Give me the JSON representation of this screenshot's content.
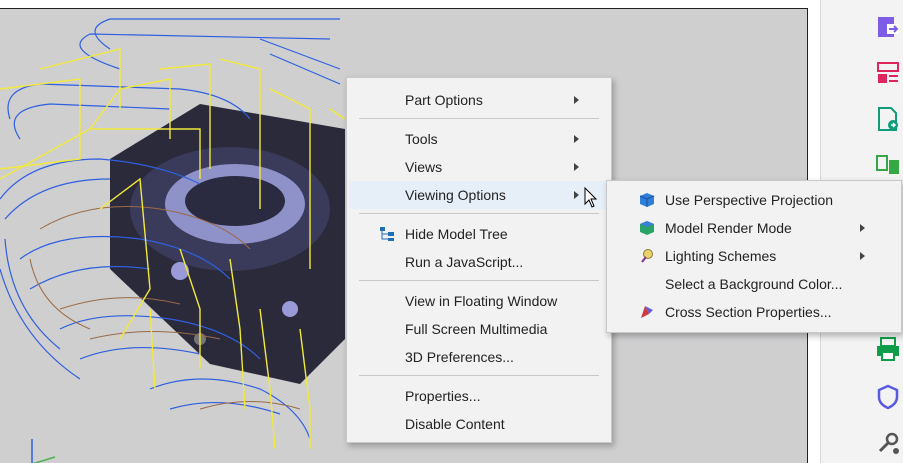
{
  "context_menu": {
    "items": [
      {
        "label": "Part Options",
        "has_submenu": true
      },
      {
        "label": "Tools",
        "has_submenu": true
      },
      {
        "label": "Views",
        "has_submenu": true
      },
      {
        "label": "Viewing Options",
        "has_submenu": true,
        "highlighted": true
      },
      {
        "label": "Hide Model Tree",
        "icon": "model-tree-icon"
      },
      {
        "label": "Run a JavaScript..."
      },
      {
        "label": "View in Floating Window"
      },
      {
        "label": "Full Screen Multimedia"
      },
      {
        "label": "3D Preferences..."
      },
      {
        "label": "Properties..."
      },
      {
        "label": "Disable Content"
      }
    ]
  },
  "viewing_options_submenu": {
    "items": [
      {
        "label": "Use Perspective Projection",
        "icon": "perspective-cube-icon"
      },
      {
        "label": "Model Render Mode",
        "icon": "render-mode-icon",
        "has_submenu": true
      },
      {
        "label": "Lighting Schemes",
        "icon": "lighting-icon",
        "has_submenu": true
      },
      {
        "label": "Select a Background Color..."
      },
      {
        "label": "Cross Section Properties...",
        "icon": "cross-section-icon"
      }
    ]
  },
  "colors": {
    "accent": "#4a63e0",
    "menu_highlight": "#e6eef8",
    "toolpath_yellow": "#f2e93a",
    "toolpath_blue": "#2f5fe0",
    "toolpath_brown": "#9a6a45"
  },
  "toolbar_icons": [
    "export-pdf-icon",
    "organize-pages-icon",
    "create-pdf-icon",
    "compare-icon",
    "print-production-icon",
    "protect-icon",
    "more-tools-icon"
  ]
}
